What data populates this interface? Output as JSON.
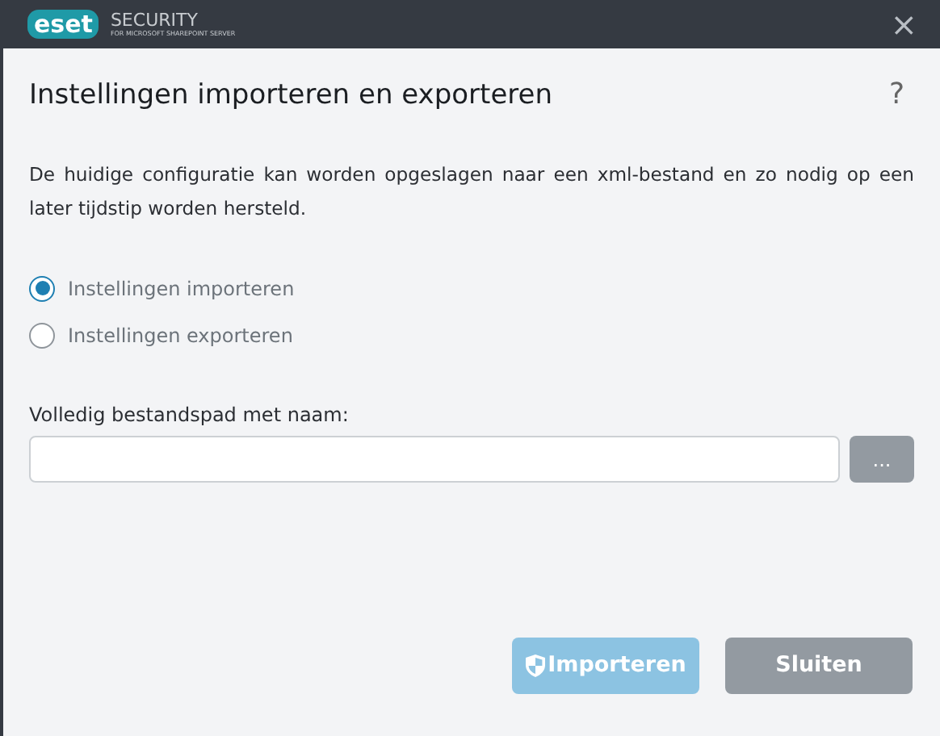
{
  "titlebar": {
    "logo": "eset",
    "product": "SECURITY",
    "subtitle": "FOR MICROSOFT SHAREPOINT SERVER",
    "close": "×"
  },
  "dialog": {
    "title": "Instellingen importeren en exporteren",
    "help": "?",
    "description": "De huidige configuratie kan worden opgeslagen naar een xml-bestand en zo nodig op een later tijdstip worden hersteld.",
    "options": [
      {
        "label": "Instellingen importeren",
        "selected": true
      },
      {
        "label": "Instellingen exporteren",
        "selected": false
      }
    ],
    "path_label": "Volledig bestandspad met naam:",
    "browse": "...",
    "buttons": [
      {
        "label": "Importeren",
        "kind": "primary",
        "disabled": true,
        "shield": true
      },
      {
        "label": "Sluiten",
        "kind": "secondary",
        "disabled": false,
        "shield": false
      }
    ]
  }
}
